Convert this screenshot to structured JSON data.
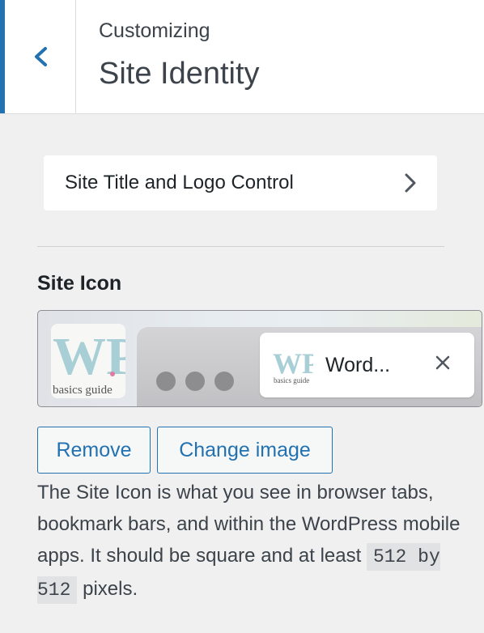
{
  "header": {
    "subtitle": "Customizing",
    "title": "Site Identity"
  },
  "section": {
    "label": "Site Title and Logo Control"
  },
  "site_icon": {
    "heading": "Site Icon",
    "logo_text": "WP",
    "logo_subtext": "basics guide",
    "tab_title": "Word...",
    "remove_label": "Remove",
    "change_label": "Change image"
  },
  "description": {
    "text_before": "The Site Icon is what you see in browser tabs, bookmark bars, and within the WordPress mobile apps. It should be square and at least ",
    "code": "512 by 512",
    "text_after": " pixels."
  },
  "colors": {
    "accent": "#2271b1",
    "background": "#f0f0f1",
    "logo_w": "#a8cfd6",
    "logo_p": "#b6b98a"
  }
}
